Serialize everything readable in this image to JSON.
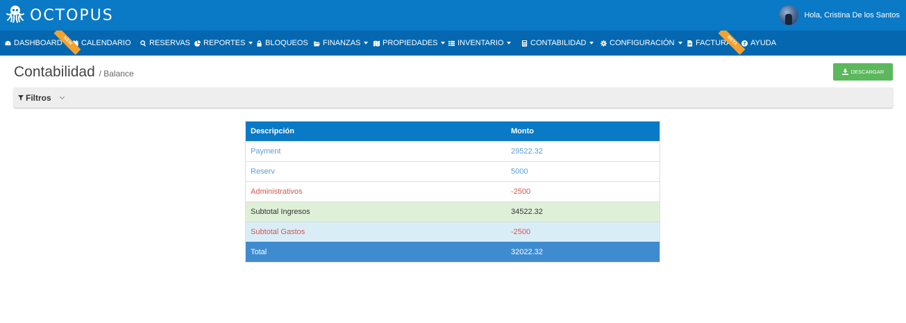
{
  "brand": {
    "name": "OCTOPUS",
    "logo_icon": "octopus-icon"
  },
  "user": {
    "greeting": "Hola, Cristina De los Santos"
  },
  "nav": {
    "dashboard": "DASHBOARD",
    "calendario": "CALENDARIO",
    "reservas": "RESERVAS",
    "reportes": "REPORTES",
    "bloqueos": "BLOQUEOS",
    "finanzas": "FINANZAS",
    "propiedades": "PROPIEDADES",
    "inventario": "INVENTARIO",
    "contabilidad": "CONTABILIDAD",
    "configuracion": "CONFIGURACIÓN",
    "factura": "FACTURA",
    "ayuda": "AYUDA",
    "ribbon_new": "NEW",
    "ribbon_beta": "BETA"
  },
  "page": {
    "title": "Contabilidad",
    "subtitle": "/ Balance"
  },
  "toolbar": {
    "download_label": "DESCARGAR"
  },
  "filters": {
    "label": "Filtros"
  },
  "table": {
    "headers": [
      "Descripción",
      "Monto"
    ],
    "rows": [
      {
        "desc": "Payment",
        "amount": "29522.32"
      },
      {
        "desc": "Reserv",
        "amount": "5000"
      },
      {
        "desc": "Administrativos",
        "amount": "-2500"
      },
      {
        "desc": "Subtotal Ingresos",
        "amount": "34522.32"
      },
      {
        "desc": "Subtotal Gastos",
        "amount": "-2500"
      },
      {
        "desc": "Total",
        "amount": "32022.32"
      }
    ]
  },
  "colors": {
    "topbar": "#0a79c6",
    "navbar": "#0467b0",
    "income": "#5b9bd5",
    "expense": "#d9534f",
    "download": "#5cb85c",
    "ribbon": "#f6a12c"
  }
}
